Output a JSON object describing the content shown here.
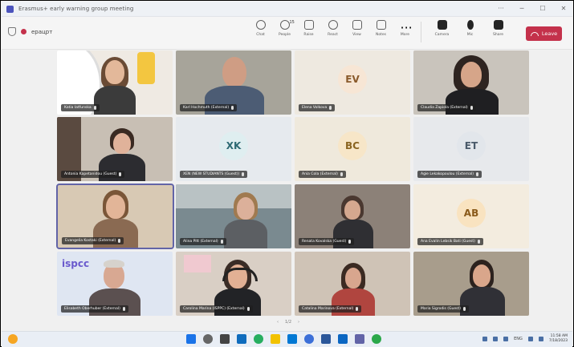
{
  "window": {
    "title": "Erasmus+ early warning group meeting",
    "controls": [
      "···",
      "─",
      "☐",
      "✕"
    ]
  },
  "toolbar": {
    "elapsed": "ерацрт",
    "tools": [
      {
        "label": "Chat",
        "icon": "chat-icon"
      },
      {
        "label": "People",
        "icon": "people-icon",
        "count": "15"
      },
      {
        "label": "Raise",
        "icon": "raise-hand-icon"
      },
      {
        "label": "React",
        "icon": "react-icon"
      },
      {
        "label": "View",
        "icon": "view-icon"
      },
      {
        "label": "Notes",
        "icon": "notes-icon"
      },
      {
        "label": "More",
        "icon": "more-icon"
      }
    ],
    "media": [
      {
        "label": "Camera",
        "icon": "camera-icon"
      },
      {
        "label": "Mic",
        "icon": "mic-icon"
      },
      {
        "label": "Share",
        "icon": "share-icon"
      }
    ],
    "leave_label": "Leave",
    "leave_color": "#c4314b"
  },
  "participants": [
    {
      "name": "Katia Iatfunska",
      "avatar": null
    },
    {
      "name": "Karl Hochmuth (External)",
      "avatar": null
    },
    {
      "name": "Elena Volkova",
      "avatar": "EV",
      "avatar_bg": "#f7e6d5",
      "avatar_fg": "#8a5a2b"
    },
    {
      "name": "Claudia Zapiola (External)",
      "avatar": null
    },
    {
      "name": "Antonia Kapetanidou (Guest)",
      "avatar": null
    },
    {
      "name": "XEN (NEW STUDIANTS (Guest))",
      "avatar": "XK",
      "avatar_bg": "#dfeef0",
      "avatar_fg": "#2d6a73"
    },
    {
      "name": "Ania Cola (External)",
      "avatar": "BC",
      "avatar_bg": "#f7e6c8",
      "avatar_fg": "#8a6420"
    },
    {
      "name": "Agie Lekakopoulou (External)",
      "avatar": "ET",
      "avatar_bg": "#e2e6eb",
      "avatar_fg": "#4a5a6a"
    },
    {
      "name": "Evangelia Kostaki (External)",
      "avatar": null
    },
    {
      "name": "Alina Pitt (External)",
      "avatar": null
    },
    {
      "name": "Renata Kovalska (Guest)",
      "avatar": null
    },
    {
      "name": "Ana Evalin Lebsik Bati (Guest)",
      "avatar": "AB",
      "avatar_bg": "#f9e3c0",
      "avatar_fg": "#8a5a1a"
    },
    {
      "name": "Elisabeth Oberhuber (External)",
      "avatar": null
    },
    {
      "name": "Carolina Marina (ISPPC) (External)",
      "avatar": null
    },
    {
      "name": "Catalina Marinova (External)",
      "avatar": null
    },
    {
      "name": "Maria Sigrodis (Guest)",
      "avatar": null
    }
  ],
  "tile_logos": {
    "ispcc": "ispcc"
  },
  "pager": {
    "prev": "‹",
    "page": "1/2",
    "next": "›"
  },
  "taskbar": {
    "tray_lang": "ENG",
    "time": "11:58 AM",
    "date": "7/18/2023"
  }
}
